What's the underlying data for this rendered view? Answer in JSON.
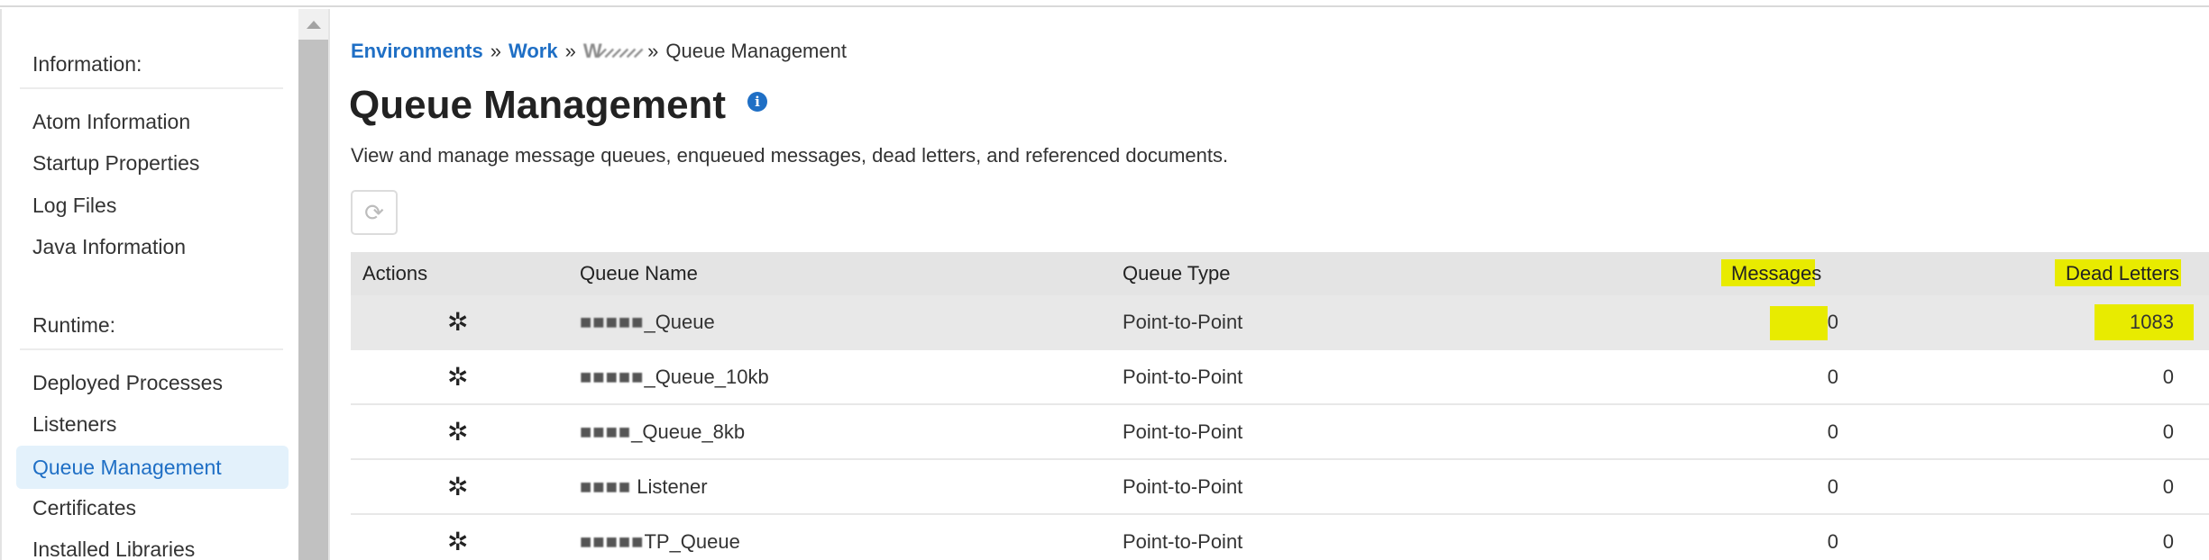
{
  "sidebar": {
    "information_heading": "Information:",
    "information_items": [
      {
        "label": "Atom Information"
      },
      {
        "label": "Startup Properties"
      },
      {
        "label": "Log Files"
      },
      {
        "label": "Java Information"
      }
    ],
    "runtime_heading": "Runtime:",
    "runtime_items": [
      {
        "label": "Deployed Processes"
      },
      {
        "label": "Listeners"
      },
      {
        "label": "Queue Management",
        "active": true
      },
      {
        "label": "Certificates"
      },
      {
        "label": "Installed Libraries"
      }
    ]
  },
  "breadcrumb": {
    "items": [
      {
        "label": "Environments",
        "link": true
      },
      {
        "label": "Work",
        "link": true
      },
      {
        "label": "W̷ ̷ ̷ ̷ ̷ ̷",
        "link": true,
        "obscured": true
      }
    ],
    "separator": "»",
    "current": "Queue Management"
  },
  "page": {
    "title": "Queue Management",
    "info_icon_glyph": "i",
    "description": "View and manage message queues, enqueued messages, dead letters, and referenced documents.",
    "refresh_glyph": "⟳"
  },
  "table": {
    "columns": {
      "actions": "Actions",
      "queue_name": "Queue Name",
      "queue_type": "Queue Type",
      "messages": "Messages",
      "dead_letters": "Dead Letters"
    },
    "action_icon_glyph": "✲",
    "rows": [
      {
        "name_obscured": "■■■■■",
        "name_suffix": "_Queue",
        "type": "Point-to-Point",
        "messages": "0",
        "dead_letters": "1083"
      },
      {
        "name_obscured": "■■■■■",
        "name_suffix": "_Queue_10kb",
        "type": "Point-to-Point",
        "messages": "0",
        "dead_letters": "0"
      },
      {
        "name_obscured": "■■■■",
        "name_suffix": "_Queue_8kb",
        "type": "Point-to-Point",
        "messages": "0",
        "dead_letters": "0"
      },
      {
        "name_obscured": "■■■■",
        "name_suffix": " Listener",
        "type": "Point-to-Point",
        "messages": "0",
        "dead_letters": "0"
      },
      {
        "name_obscured": "■■■■■",
        "name_suffix": "TP_Queue",
        "type": "Point-to-Point",
        "messages": "0",
        "dead_letters": "0"
      }
    ]
  },
  "colors": {
    "accent": "#1f6fc5",
    "active_bg": "#e3f1fb",
    "highlight": "#e8eb00",
    "header_bg": "#e4e4e4"
  }
}
